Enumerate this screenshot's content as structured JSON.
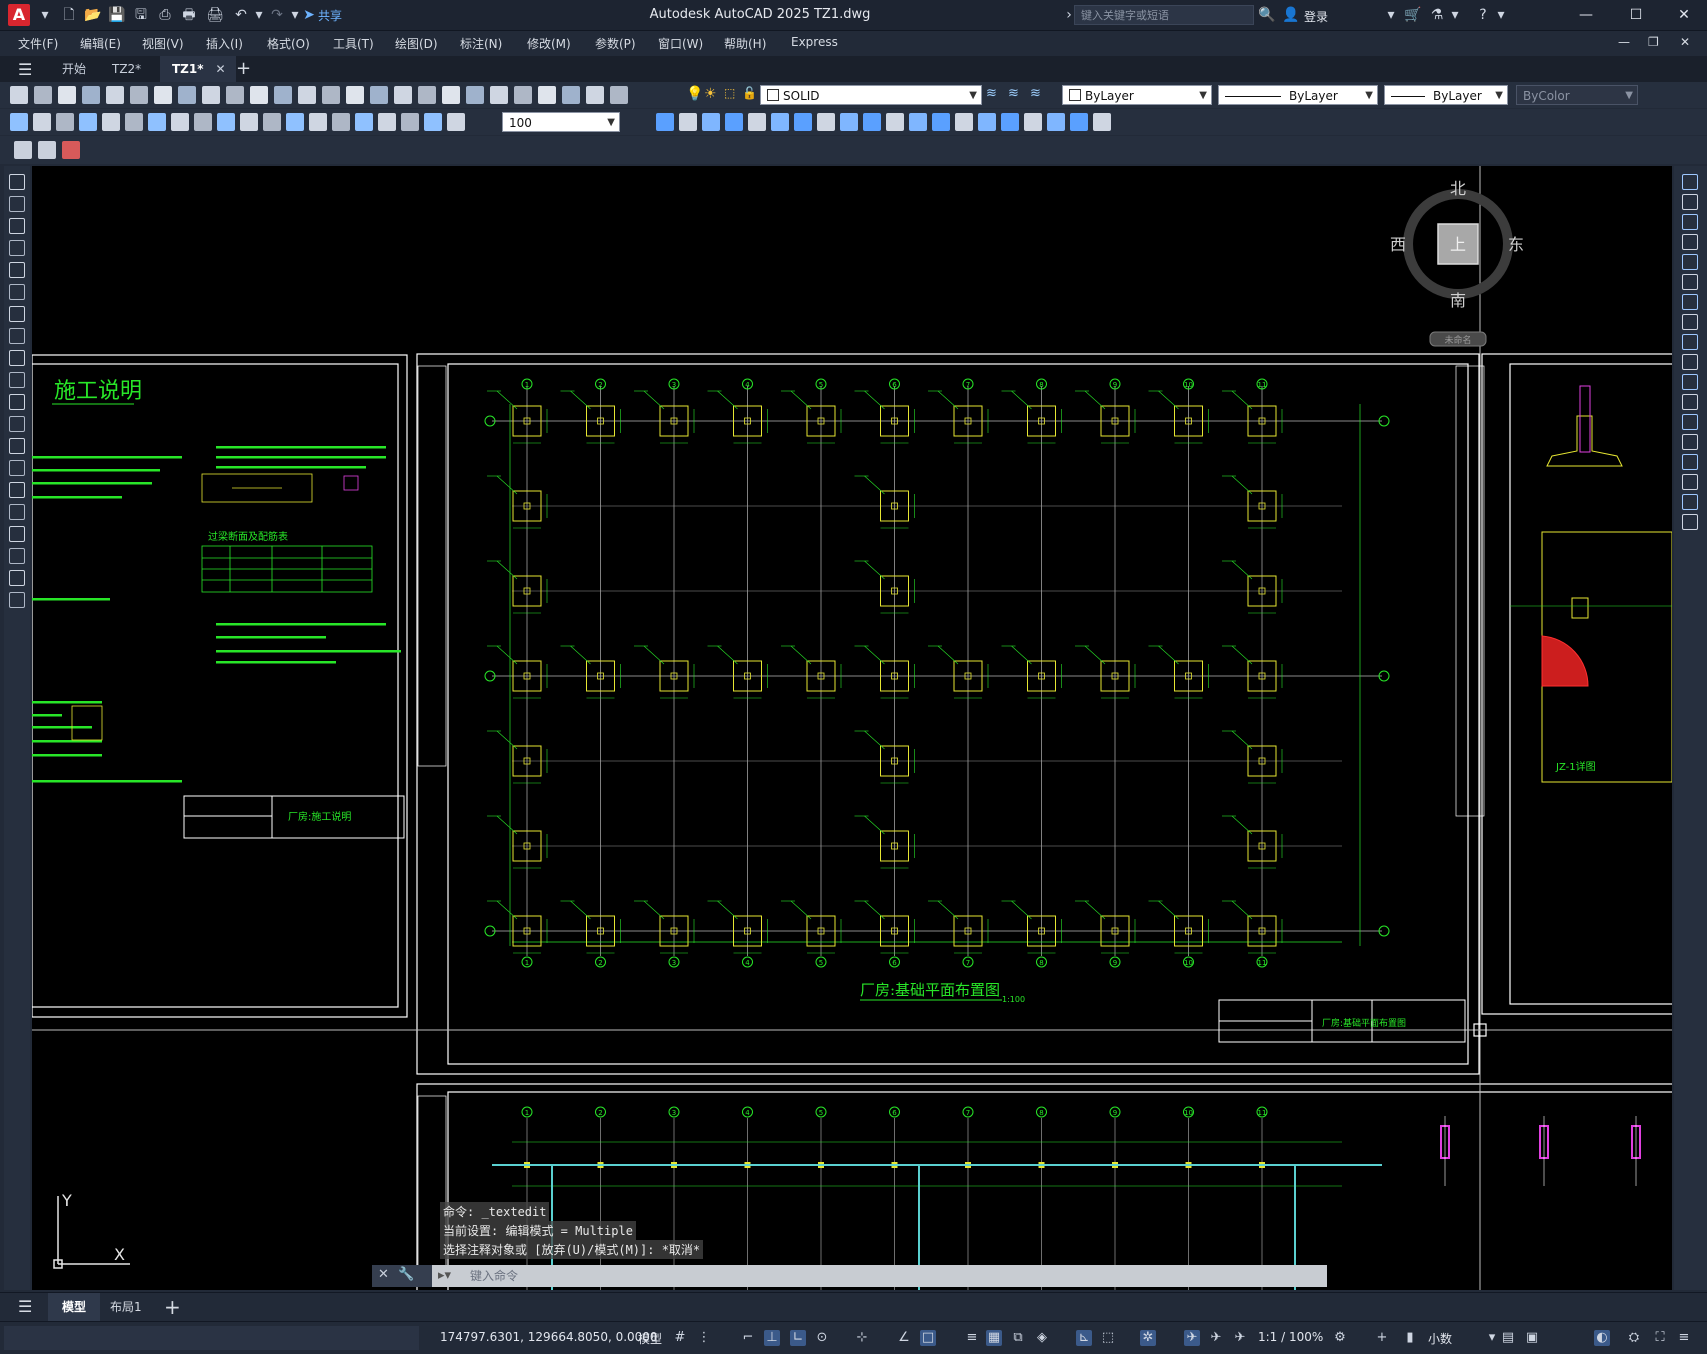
{
  "app": {
    "logo_letter": "A",
    "title": "Autodesk AutoCAD 2025    TZ1.dwg",
    "share_label": "共享",
    "search_placeholder": "键入关键字或短语",
    "login_label": "登录"
  },
  "menu": [
    "文件(F)",
    "编辑(E)",
    "视图(V)",
    "插入(I)",
    "格式(O)",
    "工具(T)",
    "绘图(D)",
    "标注(N)",
    "修改(M)",
    "参数(P)",
    "窗口(W)",
    "帮助(H)",
    "Express"
  ],
  "file_tabs": [
    {
      "label": "开始"
    },
    {
      "label": "TZ2*"
    },
    {
      "label": "TZ1*"
    }
  ],
  "toolbar": {
    "layer_name": "SOLID",
    "color_value": "ByLayer",
    "linetype_value": "ByLayer",
    "lineweight_value": "ByLayer",
    "plotstyle_value": "ByColor",
    "scale_value": "100"
  },
  "viewcube": {
    "north": "北",
    "south": "南",
    "east": "东",
    "west": "西",
    "top_face": "上",
    "ucs_label": "未命名"
  },
  "drawing": {
    "left_title": "施工说明",
    "left_sheet_title": "厂房:施工说明",
    "main_title": "厂房:基础平面布置图",
    "main_scale": "1:100",
    "main_sheet_title": "厂房:基础平面布置图",
    "detail_label": "JZ-1详图",
    "table_title": "过梁断面及配筋表",
    "grid_numbers": [
      "1",
      "2",
      "3",
      "4",
      "5",
      "6",
      "7",
      "8",
      "9",
      "10",
      "11"
    ],
    "ucs_x": "X",
    "ucs_y": "Y"
  },
  "command": {
    "history": [
      "命令: _textedit",
      "当前设置: 编辑模式 = Multiple",
      "选择注释对象或 [放弃(U)/模式(M)]: *取消*"
    ],
    "placeholder": "键入命令"
  },
  "layout_tabs": [
    {
      "label": "模型"
    },
    {
      "label": "布局1"
    }
  ],
  "status": {
    "coordinates": "174797.6301, 129664.8050, 0.0000",
    "mode": "模型",
    "annotation_scale": "1:1 / 100%",
    "units": "小数"
  }
}
